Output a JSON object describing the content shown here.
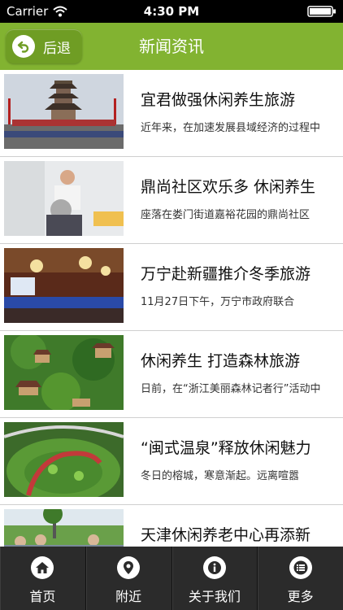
{
  "status_bar": {
    "carrier": "Carrier",
    "time": "4:30 PM"
  },
  "nav": {
    "back_label": "后退",
    "title": "新闻资讯"
  },
  "news": [
    {
      "title": "宜君做强休闲养生旅游",
      "summary": "近年来，在加速发展县域经济的过程中"
    },
    {
      "title": "鼎尚社区欢乐多 休闲养生",
      "summary": "座落在娄门街道嘉裕花园的鼎尚社区"
    },
    {
      "title": "万宁赴新疆推介冬季旅游",
      "summary": "11月27日下午，万宁市政府联合"
    },
    {
      "title": "休闲养生 打造森林旅游",
      "summary": "日前，在“浙江美丽森林记者行”活动中"
    },
    {
      "title": "“闽式温泉”释放休闲魅力",
      "summary": "冬日的榕城，寒意渐起。远离喧嚣"
    },
    {
      "title": "天津休闲养老中心再添新",
      "summary": ""
    }
  ],
  "tabs": [
    {
      "label": "首页",
      "icon": "home-icon"
    },
    {
      "label": "附近",
      "icon": "location-pin-icon"
    },
    {
      "label": "关于我们",
      "icon": "info-icon"
    },
    {
      "label": "更多",
      "icon": "list-icon"
    }
  ],
  "colors": {
    "nav_green": "#82b331",
    "tab_bar": "#2b2b2b"
  }
}
